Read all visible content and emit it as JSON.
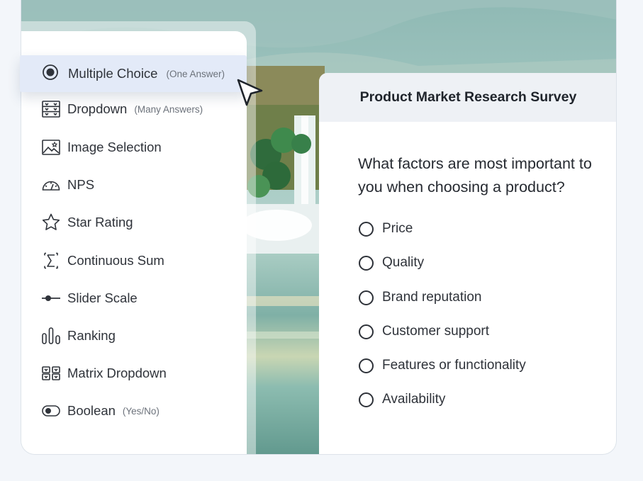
{
  "toolbox": {
    "selected": {
      "label": "Multiple Choice",
      "sub": "(One Answer)",
      "icon": "radio-selected-icon"
    },
    "items": [
      {
        "label": "Dropdown",
        "sub": "(Many Answers)",
        "icon": "dropdown-icon"
      },
      {
        "label": "Image Selection",
        "sub": "",
        "icon": "image-icon"
      },
      {
        "label": "NPS",
        "sub": "",
        "icon": "gauge-icon"
      },
      {
        "label": "Star Rating",
        "sub": "",
        "icon": "star-icon"
      },
      {
        "label": "Continuous Sum",
        "sub": "",
        "icon": "sigma-icon"
      },
      {
        "label": "Slider Scale",
        "sub": "",
        "icon": "slider-icon"
      },
      {
        "label": "Ranking",
        "sub": "",
        "icon": "ranking-icon"
      },
      {
        "label": "Matrix Dropdown",
        "sub": "",
        "icon": "matrix-icon"
      },
      {
        "label": "Boolean",
        "sub": "(Yes/No)",
        "icon": "toggle-icon"
      }
    ]
  },
  "survey": {
    "title": "Product Market Research Survey",
    "question": "What factors are most important to you when choosing a product?",
    "options": [
      "Price",
      "Quality",
      "Brand reputation",
      "Customer support",
      "Features or functionality",
      "Availability"
    ]
  },
  "colors": {
    "selected_bg": "#e3eaf8",
    "card_header": "#eef1f5",
    "page_bg": "#f3f6fa"
  }
}
